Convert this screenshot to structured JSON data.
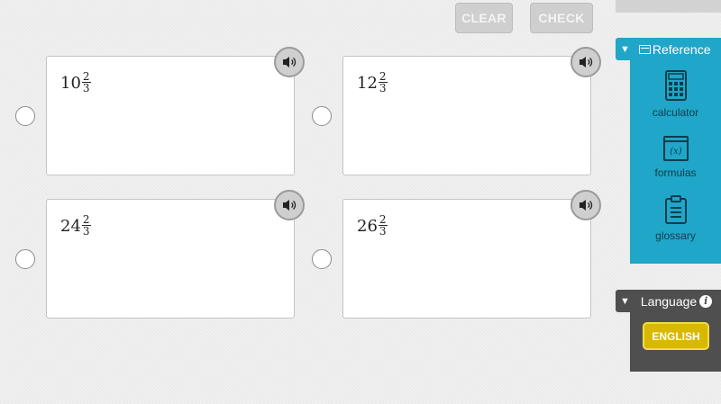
{
  "toolbar": {
    "clear_label": "CLEAR",
    "check_label": "CHECK"
  },
  "answers": [
    {
      "whole": "10",
      "numerator": "2",
      "denominator": "3"
    },
    {
      "whole": "12",
      "numerator": "2",
      "denominator": "3"
    },
    {
      "whole": "24",
      "numerator": "2",
      "denominator": "3"
    },
    {
      "whole": "26",
      "numerator": "2",
      "denominator": "3"
    }
  ],
  "reference": {
    "title": "Reference",
    "tools": [
      {
        "label": "calculator",
        "icon": "calculator-icon"
      },
      {
        "label": "formulas",
        "icon": "formula-icon",
        "glyph": "(x)"
      },
      {
        "label": "glossary",
        "icon": "clipboard-icon"
      }
    ]
  },
  "language": {
    "title": "Language",
    "info_glyph": "i",
    "selected": "ENGLISH"
  },
  "colors": {
    "reference_panel": "#20a6c8",
    "language_panel": "#4f4f4f",
    "english_button": "#d9b800",
    "disabled_button": "#cfcfcf"
  }
}
